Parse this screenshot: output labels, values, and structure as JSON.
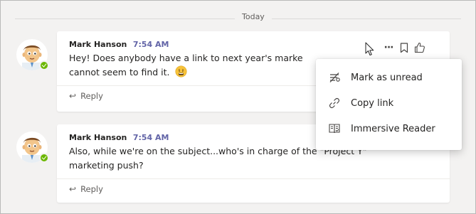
{
  "date_divider": "Today",
  "messages": [
    {
      "author": "Mark Hanson",
      "time": "7:54 AM",
      "line1": "Hey! Does anybody have a link to next year's marke",
      "line2": "cannot seem to find it.",
      "emoji": "worried-face",
      "reply": "Reply"
    },
    {
      "author": "Mark Hanson",
      "time": "7:54 AM",
      "line1": "Also, while we're on the subject...who's in charge of the \"Project Y\"",
      "line2": "marketing push?",
      "reply": "Reply"
    }
  ],
  "toolbar": {
    "more": "···",
    "icons": [
      "more-options-icon",
      "bookmark-icon",
      "like-icon"
    ]
  },
  "context_menu": {
    "items": [
      {
        "label": "Mark as unread",
        "icon": "mark-unread-icon"
      },
      {
        "label": "Copy link",
        "icon": "link-icon"
      },
      {
        "label": "Immersive Reader",
        "icon": "immersive-reader-icon"
      }
    ]
  },
  "colors": {
    "accent": "#6264a7",
    "presence": "#6bb700",
    "background": "#f3f2f1"
  }
}
